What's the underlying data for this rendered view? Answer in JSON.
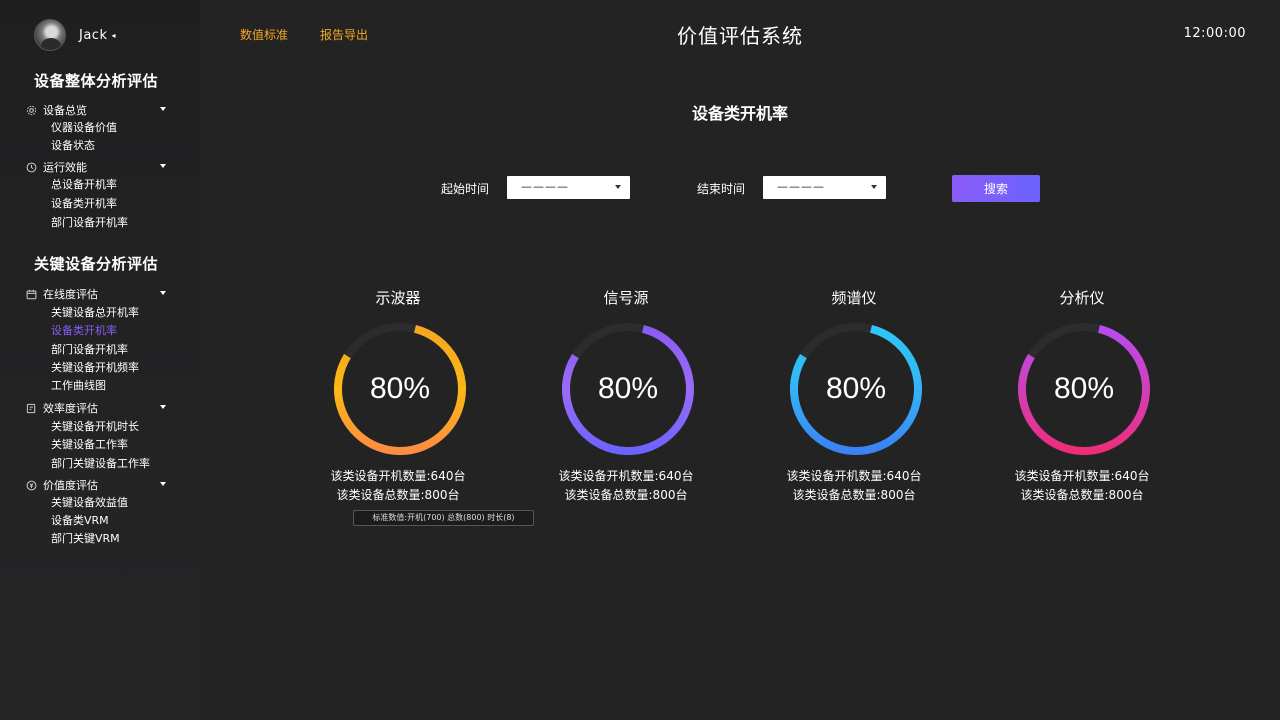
{
  "user": {
    "name": "Jack",
    "caret": "◂"
  },
  "sidebar": {
    "sections": [
      {
        "title": "设备整体分析评估"
      },
      {
        "title": "关键设备分析评估"
      }
    ],
    "groups": [
      {
        "label": "设备总览",
        "icon": "gear-icon",
        "items": [
          "仪器设备价值",
          "设备状态"
        ]
      },
      {
        "label": "运行效能",
        "icon": "clock-icon",
        "items": [
          "总设备开机率",
          "设备类开机率",
          "部门设备开机率"
        ]
      },
      {
        "label": "在线度评估",
        "icon": "calendar-icon",
        "items": [
          "关键设备总开机率",
          "设备类开机率",
          "部门设备开机率",
          "关键设备开机频率",
          "工作曲线图"
        ]
      },
      {
        "label": "效率度评估",
        "icon": "edit-icon",
        "items": [
          "关键设备开机时长",
          "关键设备工作率",
          "部门关键设备工作率"
        ]
      },
      {
        "label": "价值度评估",
        "icon": "coin-icon",
        "items": [
          "关键设备效益值",
          "设备类VRM",
          "部门关键VRM"
        ]
      }
    ],
    "active_item": "在线度评估/设备类开机率"
  },
  "topbar": {
    "links": [
      "数值标准",
      "报告导出"
    ],
    "title": "价值评估系统",
    "clock": "12:00:00"
  },
  "page": {
    "title": "设备类开机率",
    "filters": {
      "start_label": "起始时间",
      "start_value": "————",
      "end_label": "结束时间",
      "end_value": "————",
      "search_label": "搜索"
    }
  },
  "cards": [
    {
      "name": "示波器",
      "percent": "80%",
      "value": 0.8,
      "on_count": "该类设备开机数量:640台",
      "total_count": "该类设备总数量:800台",
      "gradient": [
        "#f5a623",
        "#fcb814",
        "#ff8c42"
      ]
    },
    {
      "name": "信号源",
      "percent": "80%",
      "value": 0.8,
      "on_count": "该类设备开机数量:640台",
      "total_count": "该类设备总数量:800台",
      "gradient": [
        "#8a5cf6",
        "#9b6bf7",
        "#6c63ff"
      ]
    },
    {
      "name": "频谱仪",
      "percent": "80%",
      "value": 0.8,
      "on_count": "该类设备开机数量:640台",
      "total_count": "该类设备总数量:800台",
      "gradient": [
        "#2fc6f6",
        "#35b3f7",
        "#3b82f6"
      ]
    },
    {
      "name": "分析仪",
      "percent": "80%",
      "value": 0.8,
      "on_count": "该类设备开机数量:640台",
      "total_count": "该类设备总数量:800台",
      "gradient": [
        "#b54cf0",
        "#d13fb8",
        "#ee2d7a"
      ]
    }
  ],
  "tooltip": "标准数值:开机(700) 总数(800) 时长(8)",
  "colors": {
    "background": "#232324",
    "accent_orange": "#f5a623",
    "accent_purple": "#8a5cf6",
    "track": "#2c2c2e"
  }
}
